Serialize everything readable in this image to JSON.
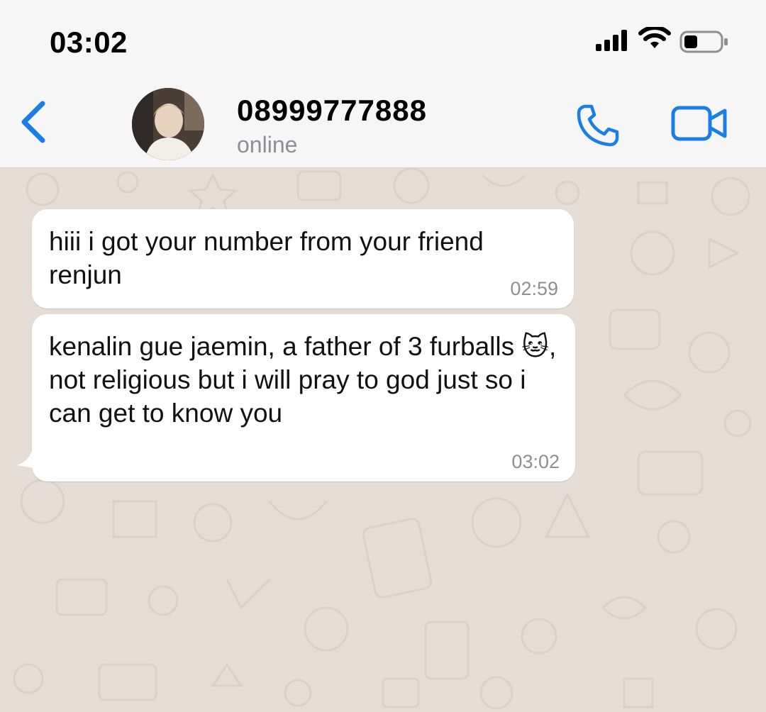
{
  "status_bar": {
    "time": "03:02",
    "icons": [
      "signal-icon",
      "wifi-icon",
      "battery-icon"
    ]
  },
  "header": {
    "back_icon": "chevron-left-icon",
    "contact_name": "08999777888",
    "contact_status": "online",
    "call_icon": "phone-icon",
    "video_icon": "video-camera-icon",
    "accent_color": "#1a7ee6"
  },
  "messages": [
    {
      "text": "hiii i got your number from your friend renjun",
      "time": "02:59",
      "direction": "incoming"
    },
    {
      "text": "kenalin gue jaemin, a father of 3 furballs 🐱, not religious but i will pray to god just so i can get to know you",
      "time": "03:02",
      "direction": "incoming"
    }
  ],
  "colors": {
    "chat_background": "#e5ddd5",
    "bubble_incoming": "#ffffff",
    "header_background": "#f6f6f6"
  }
}
